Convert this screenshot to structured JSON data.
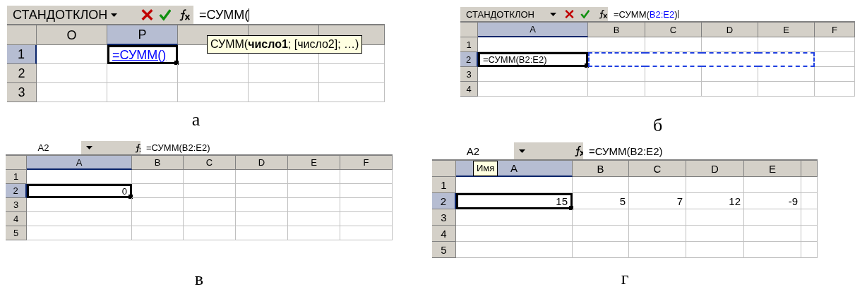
{
  "panels": [
    {
      "caption": "а",
      "name_box": "СТАНДОТКЛОН",
      "formula_editing": true,
      "formula": [
        {
          "text": "=СУММ(",
          "kind": "plain"
        }
      ],
      "tooltip": "СУММ(**число1**; [число2]; …)",
      "columns": [
        {
          "label": "O",
          "selected": false
        },
        {
          "label": "P",
          "selected": true
        }
      ],
      "rows": [
        {
          "label": "1",
          "selected": true,
          "cells": [
            null,
            {
              "text": "=СУММ()",
              "active": true,
              "editing": true
            }
          ]
        },
        {
          "label": "2",
          "selected": false,
          "cells": [
            null,
            null
          ]
        },
        {
          "label": "3",
          "selected": false,
          "cells": [
            null,
            null
          ]
        }
      ]
    },
    {
      "caption": "б",
      "name_box": "СТАНДОТКЛОН",
      "formula_editing": true,
      "formula": [
        {
          "text": "=СУММ(",
          "kind": "plain"
        },
        {
          "text": "B2:E2",
          "kind": "reference"
        },
        {
          "text": ")",
          "kind": "plain"
        }
      ],
      "columns": [
        {
          "label": "A",
          "selected": true
        },
        {
          "label": "B",
          "selected": false
        },
        {
          "label": "C",
          "selected": false
        },
        {
          "label": "D",
          "selected": false
        },
        {
          "label": "E",
          "selected": false
        },
        {
          "label": "F",
          "selected": false
        }
      ],
      "rows": [
        {
          "label": "1",
          "selected": false,
          "cells": [
            null,
            null,
            null,
            null,
            null,
            null
          ]
        },
        {
          "label": "2",
          "selected": true,
          "cells": [
            {
              "text": "=СУММ(B2:E2)",
              "active": true,
              "editing": false
            },
            {
              "in_marquee": true
            },
            {
              "in_marquee": true
            },
            {
              "in_marquee": true
            },
            {
              "in_marquee": true
            },
            null
          ]
        },
        {
          "label": "3",
          "selected": false,
          "cells": [
            null,
            null,
            null,
            null,
            null,
            null
          ]
        },
        {
          "label": "4",
          "selected": false,
          "cells": [
            null,
            null,
            null,
            null,
            null,
            null
          ]
        }
      ]
    },
    {
      "caption": "в",
      "name_box": "A2",
      "formula_editing": false,
      "formula": [
        {
          "text": "=СУММ(B2:E2)",
          "kind": "plain"
        }
      ],
      "columns": [
        {
          "label": "A",
          "selected": true
        },
        {
          "label": "B",
          "selected": false
        },
        {
          "label": "C",
          "selected": false
        },
        {
          "label": "D",
          "selected": false
        },
        {
          "label": "E",
          "selected": false
        },
        {
          "label": "F",
          "selected": false
        }
      ],
      "rows": [
        {
          "label": "1",
          "selected": false,
          "cells": [
            null,
            null,
            null,
            null,
            null,
            null
          ]
        },
        {
          "label": "2",
          "selected": true,
          "cells": [
            {
              "text": "0",
              "active": true,
              "editing": false
            },
            null,
            null,
            null,
            null,
            null
          ]
        },
        {
          "label": "3",
          "selected": false,
          "cells": [
            null,
            null,
            null,
            null,
            null,
            null
          ]
        },
        {
          "label": "4",
          "selected": false,
          "cells": [
            null,
            null,
            null,
            null,
            null,
            null
          ]
        },
        {
          "label": "5",
          "selected": false,
          "cells": [
            null,
            null,
            null,
            null,
            null,
            null
          ]
        }
      ]
    },
    {
      "caption": "г",
      "name_box": "A2",
      "formula_editing": false,
      "formula": [
        {
          "text": "=СУММ(B2:E2)",
          "kind": "plain"
        }
      ],
      "tooltip": "Имя",
      "columns": [
        {
          "label": "A",
          "selected": true
        },
        {
          "label": "B",
          "selected": false
        },
        {
          "label": "C",
          "selected": false
        },
        {
          "label": "D",
          "selected": false
        },
        {
          "label": "E",
          "selected": false
        }
      ],
      "rows": [
        {
          "label": "1",
          "selected": false,
          "cells": [
            null,
            null,
            null,
            null,
            null
          ]
        },
        {
          "label": "2",
          "selected": true,
          "cells": [
            {
              "text": "15",
              "active": true,
              "editing": false
            },
            {
              "text": "5"
            },
            {
              "text": "7"
            },
            {
              "text": "12"
            },
            {
              "text": "-9"
            }
          ]
        },
        {
          "label": "3",
          "selected": false,
          "cells": [
            null,
            null,
            null,
            null,
            null
          ]
        },
        {
          "label": "4",
          "selected": false,
          "cells": [
            null,
            null,
            null,
            null,
            null
          ]
        },
        {
          "label": "5",
          "selected": false,
          "cells": [
            null,
            null,
            null,
            null,
            null
          ]
        }
      ]
    }
  ]
}
